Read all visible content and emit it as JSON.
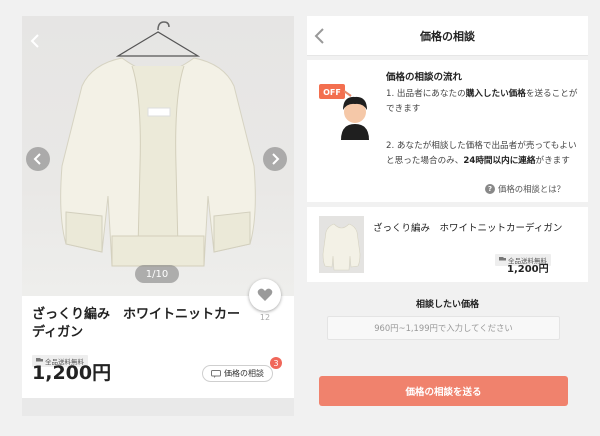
{
  "left": {
    "pager": "1/10",
    "likes": "12",
    "title": "ざっくり編み　ホワイトニットカーディガン",
    "shipping_badge": "全品送料無料",
    "price": "1,200円",
    "nego_button_label": "価格の相談",
    "nego_badge_count": "3"
  },
  "right": {
    "header_title": "価格の相談",
    "flow_title": "価格の相談の流れ",
    "step1": {
      "prefix": "1. 出品者にあなたの",
      "bold": "購入したい価格",
      "suffix": "を送ることができます"
    },
    "step2": {
      "prefix": "2. あなたが相談した価格で出品者が売ってもよいと思った場合のみ、",
      "bold": "24時間以内に連絡",
      "suffix": "がきます"
    },
    "help_link": "価格の相談とは？",
    "off_label": "OFF",
    "product": {
      "title": "ざっくり編み　ホワイトニットカーディガン",
      "shipping_badge": "全品送料無料",
      "price": "1,200円"
    },
    "nego_section_label": "相談したい価格",
    "price_input_placeholder": "960円~1,199円で入力してください",
    "send_button_label": "価格の相談を送る"
  },
  "colors": {
    "accent": "#f0826d",
    "badge": "#f0675a",
    "off_tag": "#f36f4f"
  },
  "icons": [
    "back-chevron-icon",
    "prev-arrow-icon",
    "next-arrow-icon",
    "heart-icon",
    "chat-icon",
    "question-icon",
    "truck-icon"
  ]
}
